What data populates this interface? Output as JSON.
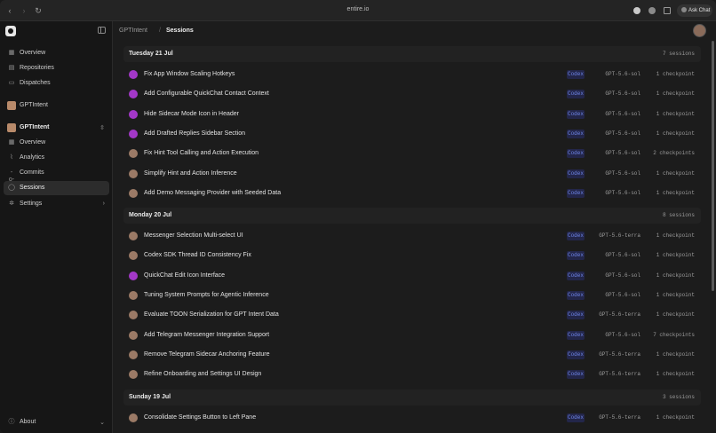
{
  "browser": {
    "url": "entire.io",
    "ask_chat_label": "Ask Chat"
  },
  "sidebar": {
    "top_items": [
      {
        "label": "Overview",
        "icon": "grid-icon"
      },
      {
        "label": "Repositories",
        "icon": "repo-icon"
      },
      {
        "label": "Dispatches",
        "icon": "book-icon"
      }
    ],
    "org_label": "GPTIntent",
    "repo_label": "GPTIntent",
    "repo_items": [
      {
        "label": "Overview",
        "icon": "grid-icon"
      },
      {
        "label": "Analytics",
        "icon": "analytics-icon"
      },
      {
        "label": "Commits",
        "icon": "commit-icon"
      },
      {
        "label": "Sessions",
        "icon": "chat-icon"
      },
      {
        "label": "Settings",
        "icon": "gear-icon"
      }
    ],
    "about_label": "About"
  },
  "header": {
    "repo": "GPTIntent",
    "page": "Sessions"
  },
  "groups": [
    {
      "day": "Tuesday 21 Jul",
      "count": "7 sessions",
      "sessions": [
        {
          "title": "Fix App Window Scaling Hotkeys",
          "agent": "Codex",
          "model": "GPT-5.6-sol",
          "checkpoints": "1 checkpoint",
          "avatar": "purple"
        },
        {
          "title": "Add Configurable QuickChat Contact Context",
          "agent": "Codex",
          "model": "GPT-5.6-sol",
          "checkpoints": "1 checkpoint",
          "avatar": "purple"
        },
        {
          "title": "Hide Sidecar Mode Icon in Header",
          "agent": "Codex",
          "model": "GPT-5.6-sol",
          "checkpoints": "1 checkpoint",
          "avatar": "purple"
        },
        {
          "title": "Add Drafted Replies Sidebar Section",
          "agent": "Codex",
          "model": "GPT-5.6-sol",
          "checkpoints": "1 checkpoint",
          "avatar": "purple"
        },
        {
          "title": "Fix Hint Tool Calling and Action Execution",
          "agent": "Codex",
          "model": "GPT-5.6-sol",
          "checkpoints": "2 checkpoints",
          "avatar": "person"
        },
        {
          "title": "Simplify Hint and Action Inference",
          "agent": "Codex",
          "model": "GPT-5.6-sol",
          "checkpoints": "1 checkpoint",
          "avatar": "person"
        },
        {
          "title": "Add Demo Messaging Provider with Seeded Data",
          "agent": "Codex",
          "model": "GPT-5.6-sol",
          "checkpoints": "1 checkpoint",
          "avatar": "person"
        }
      ]
    },
    {
      "day": "Monday 20 Jul",
      "count": "8 sessions",
      "sessions": [
        {
          "title": "Messenger Selection Multi-select UI",
          "agent": "Codex",
          "model": "GPT-5.6-terra",
          "checkpoints": "1 checkpoint",
          "avatar": "person"
        },
        {
          "title": "Codex SDK Thread ID Consistency Fix",
          "agent": "Codex",
          "model": "GPT-5.6-sol",
          "checkpoints": "1 checkpoint",
          "avatar": "person"
        },
        {
          "title": "QuickChat Edit Icon Interface",
          "agent": "Codex",
          "model": "GPT-5.6-sol",
          "checkpoints": "1 checkpoint",
          "avatar": "purple"
        },
        {
          "title": "Tuning System Prompts for Agentic Inference",
          "agent": "Codex",
          "model": "GPT-5.6-sol",
          "checkpoints": "1 checkpoint",
          "avatar": "person"
        },
        {
          "title": "Evaluate TOON Serialization for GPT Intent Data",
          "agent": "Codex",
          "model": "GPT-5.6-terra",
          "checkpoints": "1 checkpoint",
          "avatar": "person"
        },
        {
          "title": "Add Telegram Messenger Integration Support",
          "agent": "Codex",
          "model": "GPT-5.6-sol",
          "checkpoints": "7 checkpoints",
          "avatar": "person"
        },
        {
          "title": "Remove Telegram Sidecar Anchoring Feature",
          "agent": "Codex",
          "model": "GPT-5.6-terra",
          "checkpoints": "1 checkpoint",
          "avatar": "person"
        },
        {
          "title": "Refine Onboarding and Settings UI Design",
          "agent": "Codex",
          "model": "GPT-5.6-terra",
          "checkpoints": "1 checkpoint",
          "avatar": "person"
        }
      ]
    },
    {
      "day": "Sunday 19 Jul",
      "count": "3 sessions",
      "sessions": [
        {
          "title": "Consolidate Settings Button to Left Pane",
          "agent": "Codex",
          "model": "GPT-5.6-terra",
          "checkpoints": "1 checkpoint",
          "avatar": "person"
        }
      ]
    }
  ]
}
